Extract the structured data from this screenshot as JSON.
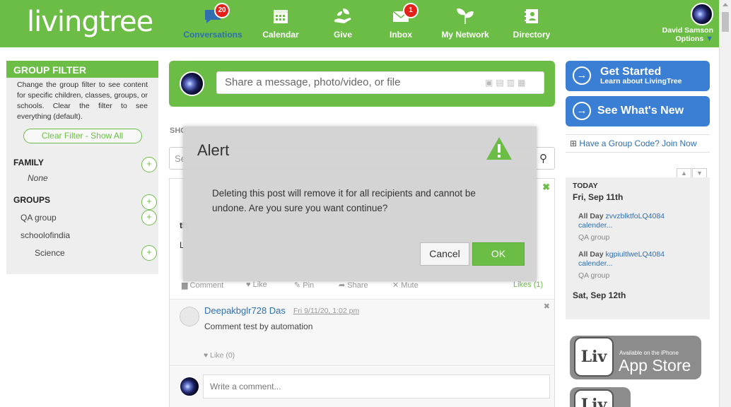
{
  "header": {
    "logo_text": "livingtree",
    "nav": [
      {
        "label": "Conversations",
        "badge": "20",
        "icon": "chat-bubble-icon"
      },
      {
        "label": "Calendar",
        "icon": "calendar-icon"
      },
      {
        "label": "Give",
        "icon": "hand-leaf-icon"
      },
      {
        "label": "Inbox",
        "badge": "1",
        "icon": "envelope-icon"
      },
      {
        "label": "My Network",
        "icon": "leaf-network-icon"
      },
      {
        "label": "Directory",
        "icon": "address-book-icon"
      }
    ],
    "user_name": "David Samson",
    "options_label": "Options"
  },
  "group_filter": {
    "title": "GROUP FILTER",
    "description": "Change the group filter to see content for specific children, classes, groups, or schools. Clear the filter to see everything (default).",
    "clear_button": "Clear Filter - Show All",
    "family_heading": "FAMILY",
    "family_none": "None",
    "groups_heading": "GROUPS",
    "groups": [
      "QA group",
      "schoolofindia",
      "Science"
    ]
  },
  "share": {
    "placeholder": "Share a message, photo/video, or file"
  },
  "feed": {
    "show_label": "SHO",
    "search_placeholder": "Se",
    "post_title_fragment": "th",
    "post_body_fragment": "L",
    "actions": {
      "comment": "Comment",
      "like": "Like",
      "pin": "Pin",
      "share": "Share",
      "mute": "Mute",
      "likes_count": "Likes (1)"
    },
    "comment": {
      "author": "Deepakbglr728 Das",
      "time": "Fri 9/11/20, 1:02 pm",
      "text": "Comment test by automation",
      "like": "Like (0)"
    },
    "write_comment_placeholder": "Write a comment..."
  },
  "alert": {
    "title": "Alert",
    "message": "Deleting this post will remove it for all recipients and cannot be undone. Are you sure you want continue?",
    "cancel": "Cancel",
    "ok": "OK",
    "warning_color": "#6cbd45"
  },
  "right": {
    "get_started": "Get Started",
    "get_started_sub": "Learn about LivingTree",
    "whats_new": "See What's New",
    "group_code": "Have a Group Code? Join Now",
    "calendar": {
      "today_label": "TODAY",
      "day1": "Fri, Sep 11th",
      "events": [
        {
          "time": "All Day",
          "title": "zvvzblktfoLQ4084",
          "sub": "calender...",
          "group": "QA group"
        },
        {
          "time": "All Day",
          "title": "kgpiultlweLQ4084",
          "sub": "calender...",
          "group": "QA group"
        }
      ],
      "day2": "Sat, Sep 12th"
    },
    "appstore_small": "Available on the iPhone",
    "appstore_big": "App Store",
    "appstore_logo": "Liv"
  },
  "colors": {
    "brand_green": "#6cbd45",
    "link_blue": "#2f6fb0",
    "button_blue": "#3b7fd4",
    "badge_red": "#e4201b"
  }
}
